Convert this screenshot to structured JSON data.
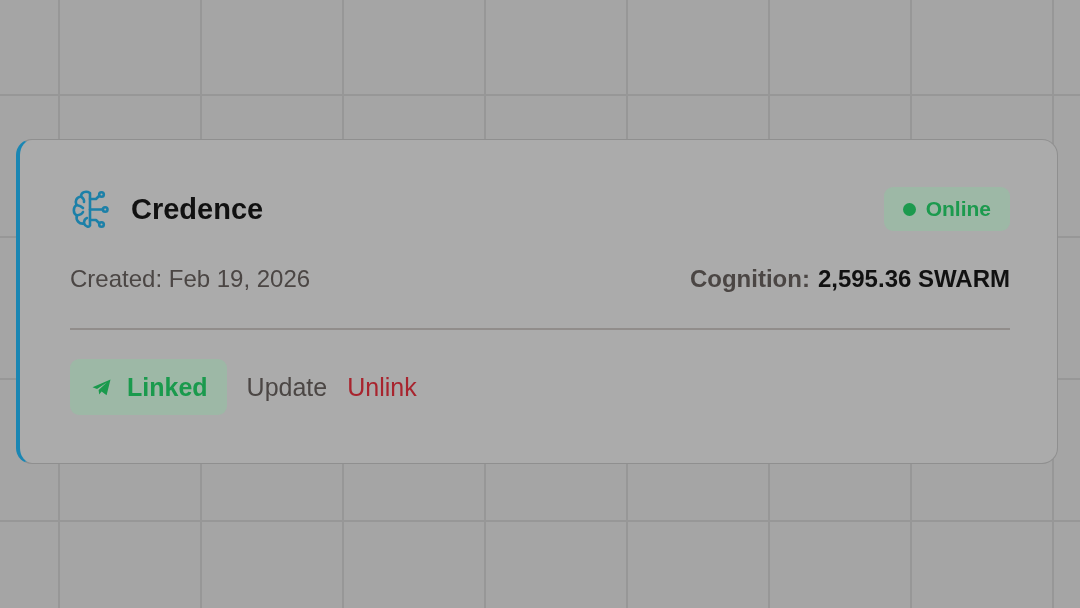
{
  "card": {
    "title": "Credence",
    "status": {
      "label": "Online",
      "on": true
    },
    "created": "Created: Feb 19, 2026",
    "cognition": {
      "label": "Cognition:",
      "value": "2,595.36 SWARM"
    },
    "actions": [
      {
        "label": "Linked",
        "kind": "status_button"
      },
      {
        "label": "Update",
        "kind": "link"
      },
      {
        "label": "Unlink",
        "kind": "danger_link"
      }
    ]
  }
}
